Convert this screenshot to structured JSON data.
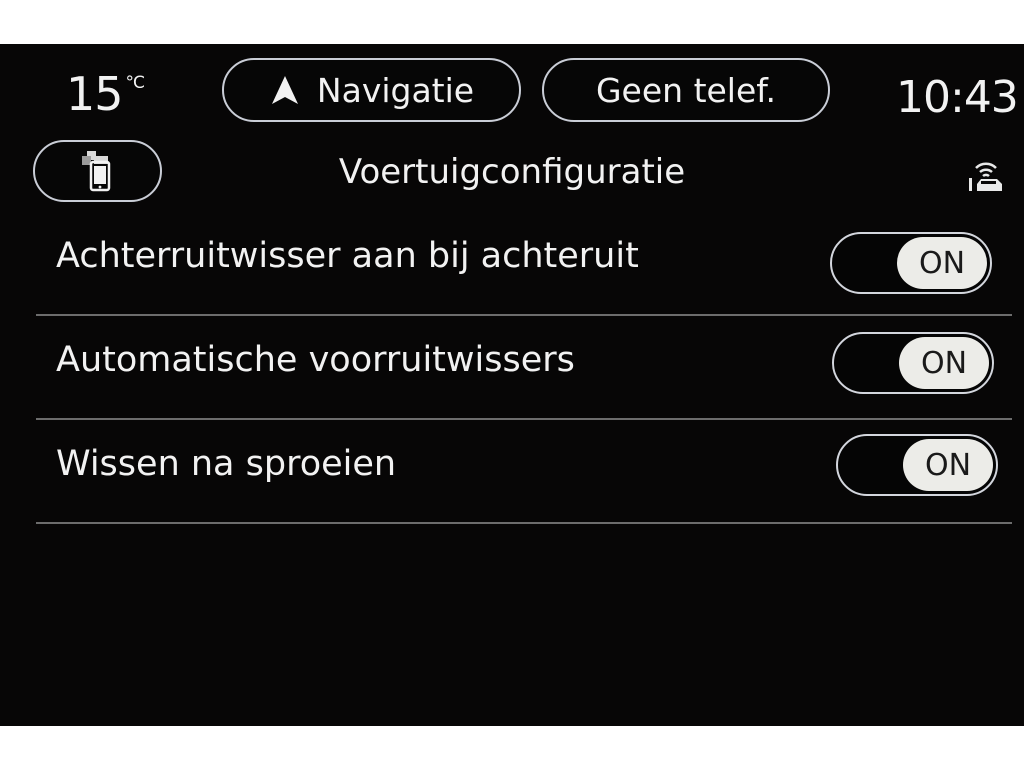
{
  "status_bar": {
    "temperature": "15",
    "temperature_unit": "°C",
    "time": "10:43",
    "navigation_label": "Navigatie",
    "phone_label": "Geen telef."
  },
  "header": {
    "title": "Voertuigconfiguratie",
    "back_icon": "phone-mirror-icon",
    "status_icon": "connected-car-icon"
  },
  "settings": [
    {
      "label": "Achterruitwisser aan bij achteruit",
      "state": "ON"
    },
    {
      "label": "Automatische voorruitwissers",
      "state": "ON"
    },
    {
      "label": "Wissen na sproeien",
      "state": "ON"
    }
  ],
  "colors": {
    "background": "#070606",
    "text": "#f2f2f2",
    "outline": "#c9cdd6",
    "toggle_knob": "#ecece8",
    "divider": "#6c6c6c"
  }
}
